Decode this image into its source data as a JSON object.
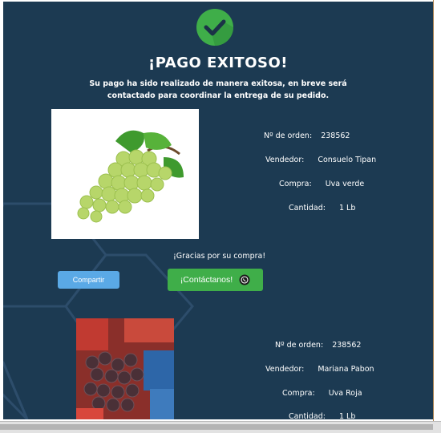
{
  "header": {
    "title": "¡PAGO EXITOSO!",
    "subtitle": "Su pago ha sido realizado de manera exitosa, en breve será contactado para coordinar la entrega de su pedido."
  },
  "labels": {
    "order": "Nº de orden:",
    "seller": "Vendedor:",
    "purchase": "Compra:",
    "quantity": "Cantidad:"
  },
  "orders": [
    {
      "order_no": "238562",
      "seller": "Consuelo Tipan",
      "purchase": "Uva verde",
      "quantity": "1 Lb",
      "image_icon": "green-grapes-image",
      "thanks": "¡Gracias por su compra!",
      "share_label": "Compartir",
      "contact_label": "¡Contáctanos!"
    },
    {
      "order_no": "238562",
      "seller": "Mariana Pabon",
      "purchase": "Uva Roja",
      "quantity": "1 Lb",
      "image_icon": "red-grapes-bag-image"
    }
  ],
  "colors": {
    "background": "#1c3a52",
    "check": "#3fae49",
    "share_button": "#5aa9e6",
    "contact_button": "#3fae49"
  }
}
